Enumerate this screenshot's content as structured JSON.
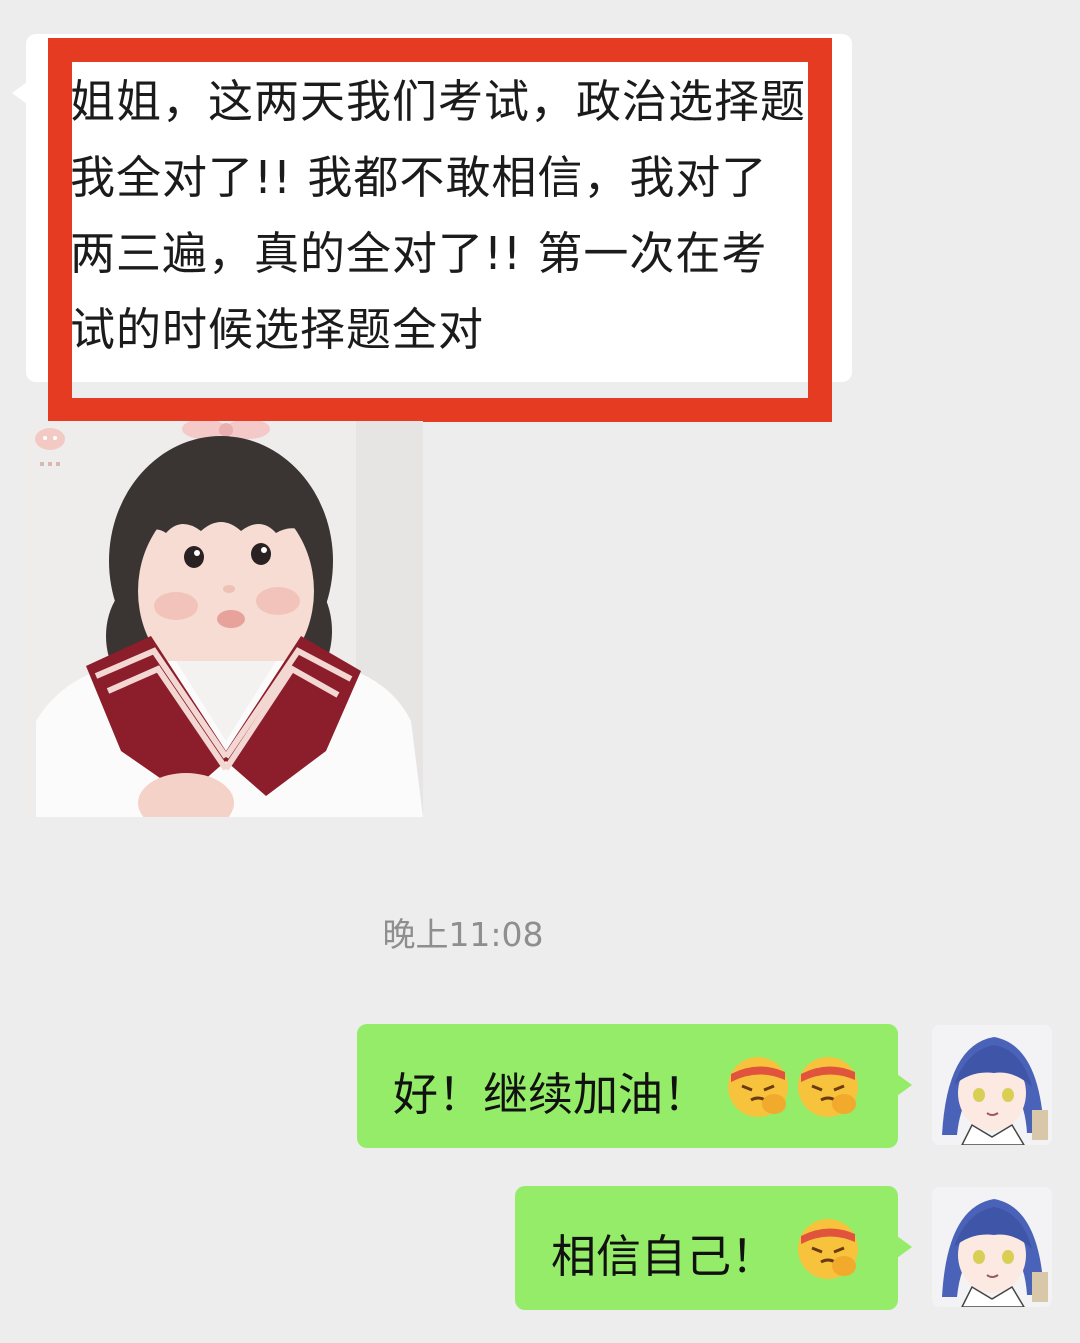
{
  "chat": {
    "incoming": {
      "text": "姐姐，这两天我们考试，政治选择题我全对了!! 我都不敢相信，我对了两三遍，真的全对了!! 第一次在考试的时候选择题全对"
    },
    "timestamp": "晚上11:08",
    "outgoing": [
      {
        "text": "好！继续加油！",
        "emoji": "determined-face-emoji",
        "emoji_count": 2
      },
      {
        "text": "相信自己！",
        "emoji": "determined-face-emoji",
        "emoji_count": 1
      }
    ]
  },
  "colors": {
    "background": "#ededed",
    "incoming_bubble": "#ffffff",
    "outgoing_bubble": "#95ec69",
    "highlight_border": "#e63b23",
    "timestamp_text": "#8e8e8e"
  },
  "icons": [
    "sticker-logo-icon",
    "determined-face-emoji",
    "user-avatar"
  ]
}
